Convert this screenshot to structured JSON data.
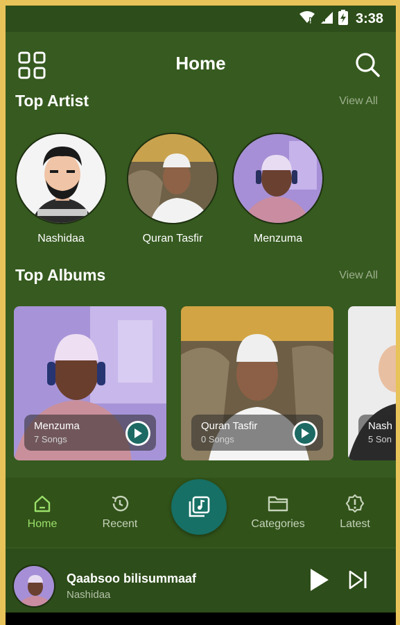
{
  "statusbar": {
    "time": "3:38",
    "icons": [
      "wifi-icon",
      "signal-icon",
      "battery-charging-icon"
    ]
  },
  "header": {
    "title": "Home",
    "menu_icon": "grid-icon",
    "search_icon": "search-icon"
  },
  "top_artist": {
    "title": "Top Artist",
    "view_all": "View All",
    "items": [
      {
        "name": "Nashidaa"
      },
      {
        "name": "Quran Tasfir"
      },
      {
        "name": "Menzuma"
      }
    ]
  },
  "top_albums": {
    "title": "Top Albums",
    "view_all": "View All",
    "items": [
      {
        "title": "Menzuma",
        "count": "7 Songs"
      },
      {
        "title": "Quran Tasfir",
        "count": "0 Songs"
      },
      {
        "title": "Nash",
        "count": "5 Son"
      }
    ]
  },
  "bottom_nav": {
    "items": [
      {
        "label": "Home",
        "icon": "home-icon",
        "active": true
      },
      {
        "label": "Recent",
        "icon": "history-icon"
      },
      {
        "label": "Categories",
        "icon": "folder-icon"
      },
      {
        "label": "Latest",
        "icon": "alert-icon"
      }
    ],
    "center_icon": "music-library-icon"
  },
  "player": {
    "song": "Qaabsoo bilisummaaf",
    "artist": "Nashidaa"
  },
  "colors": {
    "background": "#365a1f",
    "accent": "#9be06a",
    "fab": "#167065",
    "border": "#e8c35a"
  }
}
